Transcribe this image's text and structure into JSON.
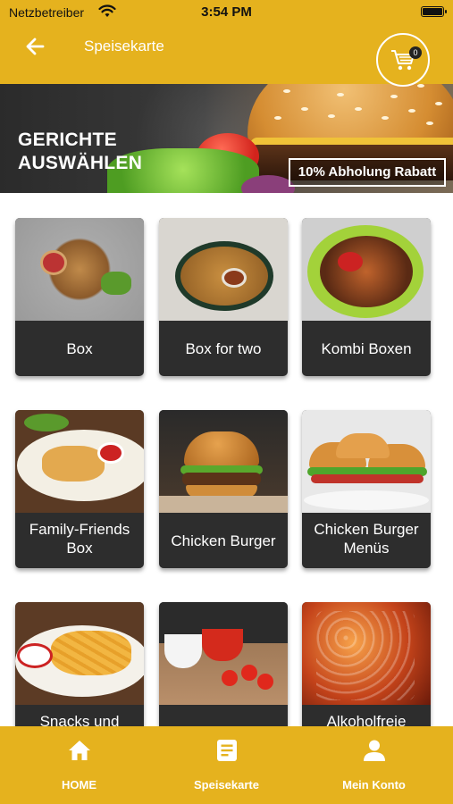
{
  "status_bar": {
    "carrier": "Netzbetreiber",
    "time": "3:54 PM"
  },
  "header": {
    "title": "Speisekarte",
    "cart_count": "0",
    "accent_color": "#e5b21e"
  },
  "banner": {
    "title_line1": "GERICHTE",
    "title_line2": "AUSWÄHLEN",
    "tag": "10% Abholung Rabatt"
  },
  "menu": [
    {
      "label": "Box"
    },
    {
      "label": "Box for two"
    },
    {
      "label": "Kombi Boxen"
    },
    {
      "label": "Family-Friends Box"
    },
    {
      "label": "Chicken Burger"
    },
    {
      "label": "Chicken Burger Menüs"
    },
    {
      "label": "Snacks und"
    },
    {
      "label": ""
    },
    {
      "label": "Alkoholfreie"
    }
  ],
  "bottom_nav": [
    {
      "label": "HOME",
      "icon": "home-icon"
    },
    {
      "label": "Speisekarte",
      "icon": "menu-list-icon"
    },
    {
      "label": "Mein Konto",
      "icon": "user-icon"
    }
  ]
}
